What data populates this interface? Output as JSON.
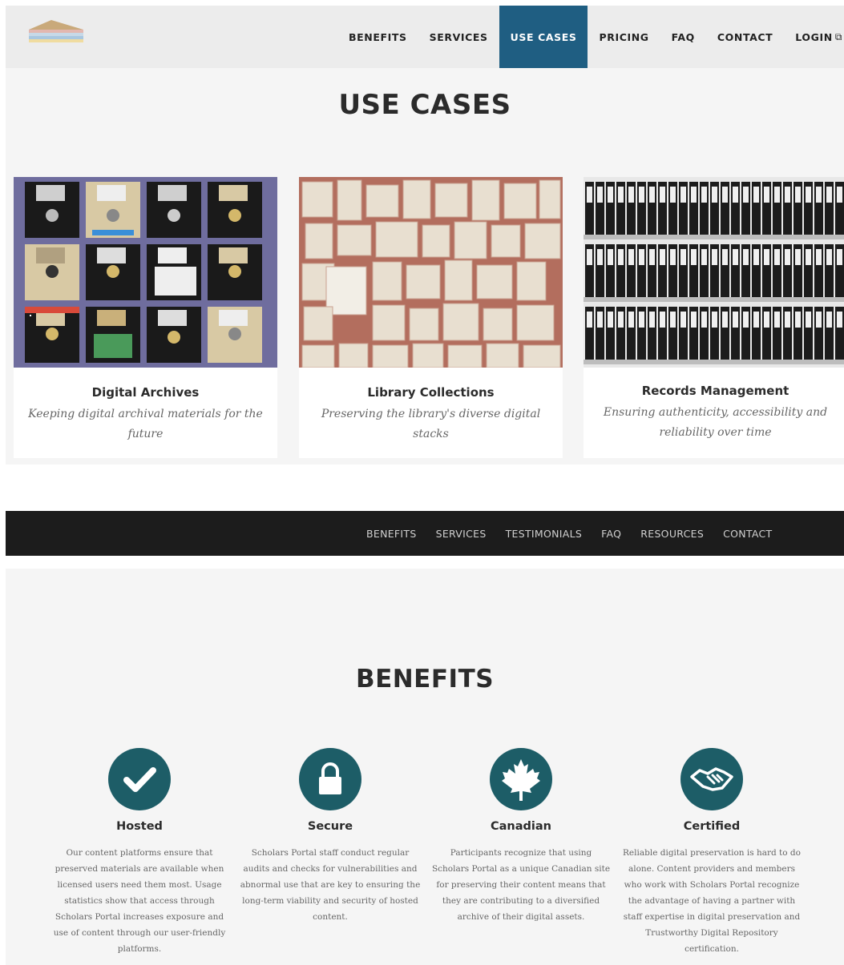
{
  "use_cases_page": {
    "nav": {
      "items": [
        {
          "label": "BENEFITS"
        },
        {
          "label": "SERVICES"
        },
        {
          "label": "USE CASES"
        },
        {
          "label": "PRICING"
        },
        {
          "label": "FAQ"
        },
        {
          "label": "CONTACT"
        },
        {
          "label": "LOGIN"
        }
      ],
      "active": "USE CASES",
      "login_icon": "external-link-icon",
      "active_color": "#1f5e82"
    },
    "title": "USE CASES",
    "cards": [
      {
        "title": "Digital Archives",
        "description": "Keeping digital archival materials for the future",
        "image": "floppy-disks-photo"
      },
      {
        "title": "Library Collections",
        "description": "Preserving the library's diverse digital stacks",
        "image": "open-book-pages-photo"
      },
      {
        "title": "Records Management",
        "description": "Ensuring authenticity, accessibility and reliability over time",
        "image": "binders-shelves-photo"
      }
    ]
  },
  "benefits_page": {
    "nav": {
      "items": [
        {
          "label": "BENEFITS"
        },
        {
          "label": "SERVICES"
        },
        {
          "label": "TESTIMONIALS"
        },
        {
          "label": "FAQ"
        },
        {
          "label": "RESOURCES"
        },
        {
          "label": "CONTACT"
        }
      ]
    },
    "title": "BENEFITS",
    "icon_color": "#1d5d67",
    "items": [
      {
        "title": "Hosted",
        "icon": "checkmark-icon",
        "text": "Our content platforms ensure that preserved materials are available when licensed users need them most. Usage statistics show that access through Scholars Portal increases exposure and use of content through our user-friendly platforms."
      },
      {
        "title": "Secure",
        "icon": "lock-icon",
        "text": "Scholars Portal staff conduct regular audits and checks for vulnerabilities and abnormal use that are key to ensuring the long-term viability and security of hosted content."
      },
      {
        "title": "Canadian",
        "icon": "maple-leaf-icon",
        "text": "Participants recognize that using Scholars Portal as a unique Canadian site for preserving their content means that they are contributing to a diversified archive of their digital assets."
      },
      {
        "title": "Certified",
        "icon": "handshake-icon",
        "text": "Reliable digital preservation is hard to do alone. Content providers and members who work with Scholars Portal recognize the advantage of having a partner with staff expertise in digital preservation and Trustworthy Digital Repository certification."
      }
    ]
  }
}
